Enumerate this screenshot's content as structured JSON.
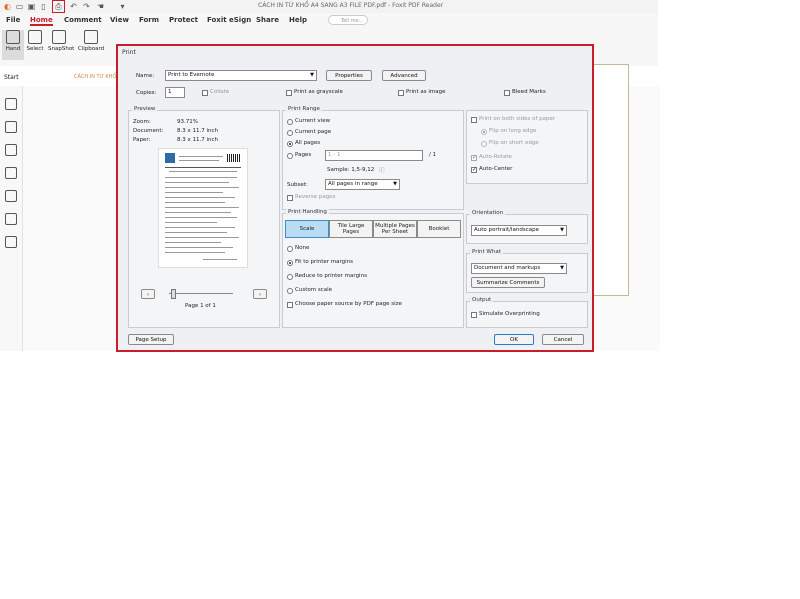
{
  "app": {
    "title": "CÁCH IN TỪ KHỔ A4 SANG A3 FILE PDF.pdf - Foxit PDF Reader",
    "search_placeholder": "Tell me...",
    "menus": [
      "File",
      "Home",
      "Comment",
      "View",
      "Form",
      "Protect",
      "Foxit eSign",
      "Share",
      "Help"
    ],
    "active_menu": "Home",
    "ribbon": [
      {
        "label": "Hand",
        "icon": "hand-icon"
      },
      {
        "label": "Select",
        "icon": "select-icon"
      },
      {
        "label": "SnapShot",
        "icon": "snapshot-icon"
      },
      {
        "label": "Clipboard",
        "icon": "clipboard-icon"
      }
    ],
    "tab_left": "Start",
    "doc_tab": "CÁCH IN TỪ KHỔ...",
    "accent_color": "#c81e2b"
  },
  "dialog": {
    "title": "Print",
    "name_label": "Name:",
    "printer": "Print to Evernote",
    "properties": "Properties",
    "advanced": "Advanced",
    "copies_label": "Copies:",
    "copies": "1",
    "collate": "Collate",
    "grayscale": "Print as grayscale",
    "as_image": "Print as image",
    "bleed": "Bleed Marks",
    "preview": {
      "title": "Preview",
      "zoom_label": "Zoom:",
      "zoom": "93.71%",
      "document_label": "Document:",
      "document": "8.3 x 11.7 inch",
      "paper_label": "Paper:",
      "paper": "8.3 x 11.7 inch",
      "page_label": "Page 1 of 1"
    },
    "range": {
      "title": "Print Range",
      "current_view": "Current view",
      "current_page": "Current page",
      "all_pages": "All pages",
      "pages": "Pages",
      "pages_value": "1 - 1",
      "pages_total": "/ 1",
      "sample": "Sample: 1,5-9,12",
      "subset_label": "Subset:",
      "subset": "All pages in range",
      "reverse": "Reverse pages"
    },
    "handling": {
      "title": "Print Handling",
      "tabs": [
        "Scale",
        "Tile Large Pages",
        "Multiple Pages Per Sheet",
        "Booklet"
      ],
      "none": "None",
      "fit": "Fit to printer margins",
      "reduce": "Reduce to printer margins",
      "custom": "Custom scale",
      "choose_source": "Choose paper source by PDF page size"
    },
    "duplex": {
      "both_sides": "Print on both sides of paper",
      "long_edge": "Flip on long edge",
      "short_edge": "Flip on short edge",
      "auto_rotate": "Auto-Rotate",
      "auto_center": "Auto-Center"
    },
    "orientation": {
      "title": "Orientation",
      "value": "Auto portrait/landscape"
    },
    "print_what": {
      "title": "Print What",
      "value": "Document and markups",
      "summarize": "Summarize Comments"
    },
    "output": {
      "title": "Output",
      "simulate": "Simulate Overprinting"
    },
    "page_setup": "Page Setup",
    "ok": "OK",
    "cancel": "Cancel"
  }
}
